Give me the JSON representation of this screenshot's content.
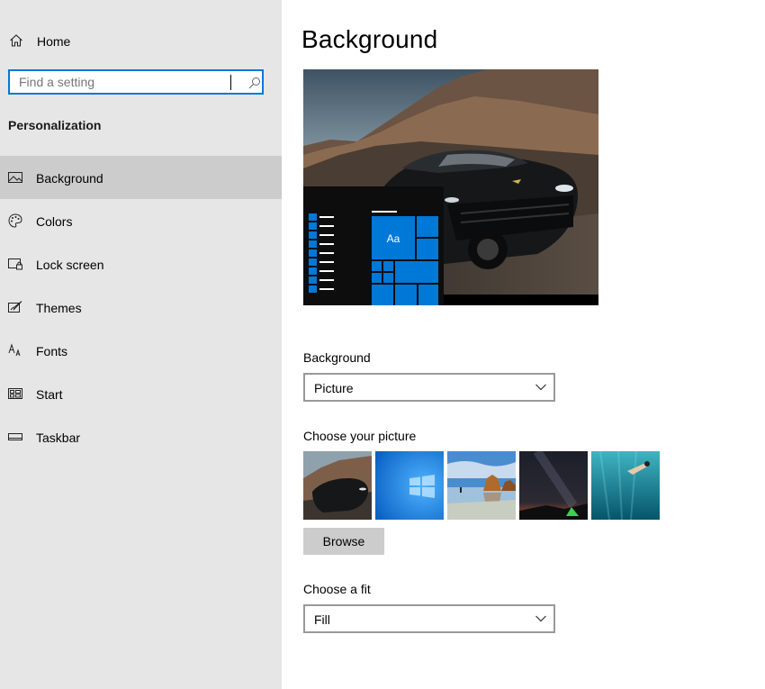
{
  "sidebar": {
    "home_label": "Home",
    "search": {
      "placeholder": "Find a setting",
      "value": ""
    },
    "section_title": "Personalization",
    "items": [
      {
        "label": "Background",
        "icon": "picture-icon",
        "active": true
      },
      {
        "label": "Colors",
        "icon": "palette-icon",
        "active": false
      },
      {
        "label": "Lock screen",
        "icon": "lock-screen-icon",
        "active": false
      },
      {
        "label": "Themes",
        "icon": "themes-icon",
        "active": false
      },
      {
        "label": "Fonts",
        "icon": "fonts-icon",
        "active": false
      },
      {
        "label": "Start",
        "icon": "start-icon",
        "active": false
      },
      {
        "label": "Taskbar",
        "icon": "taskbar-icon",
        "active": false
      }
    ]
  },
  "main": {
    "title": "Background",
    "preview": {
      "tile_text": "Aa"
    },
    "background_field": {
      "label": "Background",
      "selected": "Picture"
    },
    "picture_field": {
      "label": "Choose your picture",
      "thumbnails": [
        "car",
        "windows-blue",
        "beach-rocks",
        "night-sky-tent",
        "underwater-swimmer"
      ]
    },
    "browse_label": "Browse",
    "fit_field": {
      "label": "Choose a fit",
      "selected": "Fill"
    }
  },
  "colors": {
    "accent": "#0078d7",
    "sidebar_bg": "#e6e6e6",
    "sidebar_active": "#cccccc",
    "button_bg": "#cccccc"
  }
}
